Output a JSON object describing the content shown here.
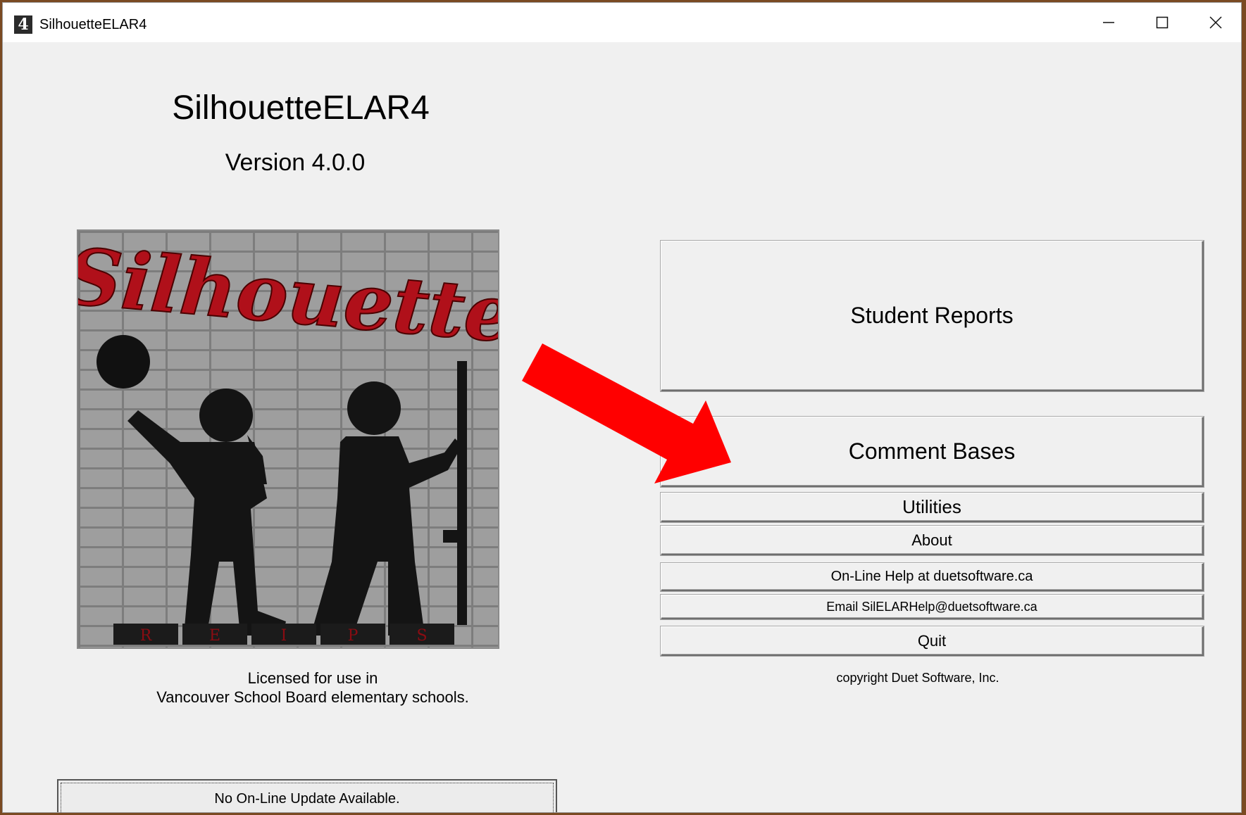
{
  "window": {
    "title": "SilhouetteELAR4",
    "app_icon_text": "4"
  },
  "main": {
    "app_title": "SilhouetteELAR4",
    "version": "Version 4.0.0",
    "logo_text": "Silhouette",
    "logo_letters": [
      "R",
      "E",
      "I",
      "P",
      "S"
    ],
    "license_line1": "Licensed for use in",
    "license_line2": "Vancouver School Board elementary schools.",
    "update_status": "No On-Line Update Available."
  },
  "menu": {
    "student_reports": "Student Reports",
    "comment_bases": "Comment Bases",
    "utilities": "Utilities",
    "about": "About",
    "online_help": "On-Line Help at duetsoftware.ca",
    "email_help": "Email SilELARHelp@duetsoftware.ca",
    "quit": "Quit",
    "copyright": "copyright Duet Software, Inc."
  },
  "colors": {
    "annotation_arrow": "#ff0000",
    "logo_text": "#b0101a"
  }
}
